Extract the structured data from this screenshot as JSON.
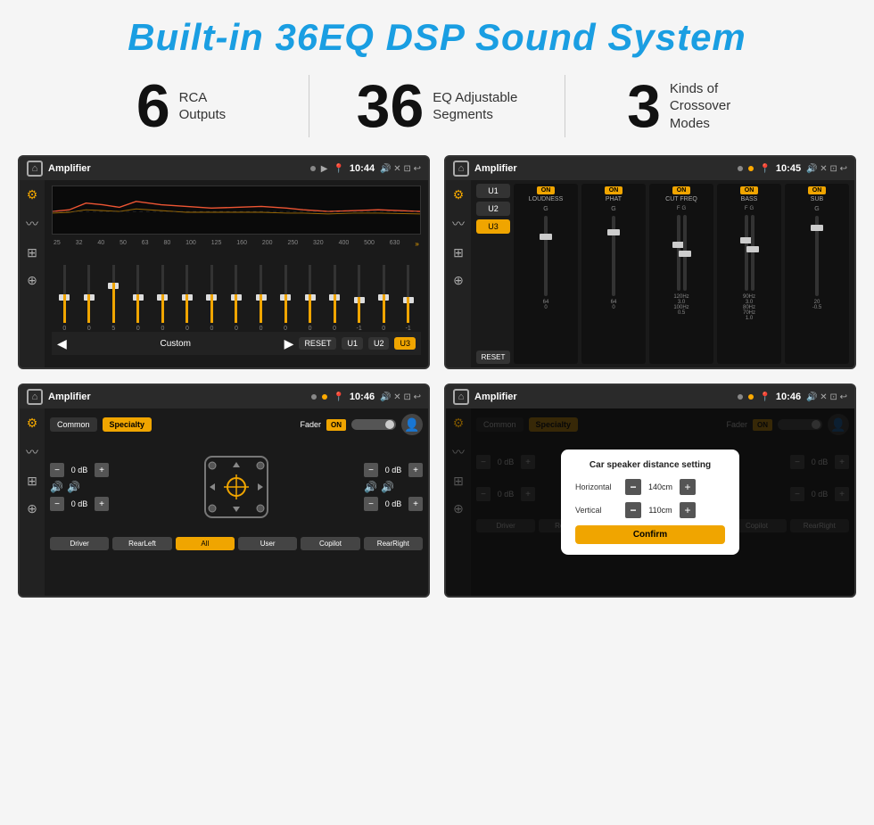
{
  "page": {
    "title": "Built-in 36EQ DSP Sound System",
    "stats": [
      {
        "number": "6",
        "label": "RCA\nOutputs"
      },
      {
        "number": "36",
        "label": "EQ Adjustable\nSegments"
      },
      {
        "number": "3",
        "label": "Kinds of\nCrossover Modes"
      }
    ]
  },
  "screens": {
    "screen1": {
      "title": "Amplifier",
      "time": "10:44",
      "freq_labels": [
        "25",
        "32",
        "40",
        "50",
        "63",
        "80",
        "100",
        "125",
        "160",
        "200",
        "250",
        "320",
        "400",
        "500",
        "630"
      ],
      "eq_values": [
        "0",
        "0",
        "5",
        "0",
        "0",
        "0",
        "0",
        "0",
        "0",
        "0",
        "0",
        "0",
        "-1",
        "0",
        "-1"
      ],
      "bottom_btns": [
        "RESET",
        "U1",
        "U2",
        "U3"
      ],
      "preset": "Custom"
    },
    "screen2": {
      "title": "Amplifier",
      "time": "10:45",
      "presets": [
        "U1",
        "U2",
        "U3"
      ],
      "active_preset": "U3",
      "channels": [
        {
          "toggle": "ON",
          "name": "LOUDNESS"
        },
        {
          "toggle": "ON",
          "name": "PHAT"
        },
        {
          "toggle": "ON",
          "name": "CUT FREQ"
        },
        {
          "toggle": "ON",
          "name": "BASS"
        },
        {
          "toggle": "ON",
          "name": "SUB"
        }
      ],
      "reset_btn": "RESET"
    },
    "screen3": {
      "title": "Amplifier",
      "time": "10:46",
      "tabs": [
        "Common",
        "Specialty"
      ],
      "active_tab": "Specialty",
      "fader_label": "Fader",
      "fader_toggle": "ON",
      "channels": [
        {
          "label": "0 dB"
        },
        {
          "label": "0 dB"
        },
        {
          "label": "0 dB"
        },
        {
          "label": "0 dB"
        }
      ],
      "bottom_btns": [
        "Driver",
        "RearLeft",
        "All",
        "User",
        "Copilot",
        "RearRight"
      ]
    },
    "screen4": {
      "title": "Amplifier",
      "time": "10:46",
      "tabs": [
        "Common",
        "Specialty"
      ],
      "dialog": {
        "title": "Car speaker distance setting",
        "rows": [
          {
            "label": "Horizontal",
            "value": "140cm"
          },
          {
            "label": "Vertical",
            "value": "110cm"
          }
        ],
        "confirm": "Confirm"
      }
    }
  }
}
